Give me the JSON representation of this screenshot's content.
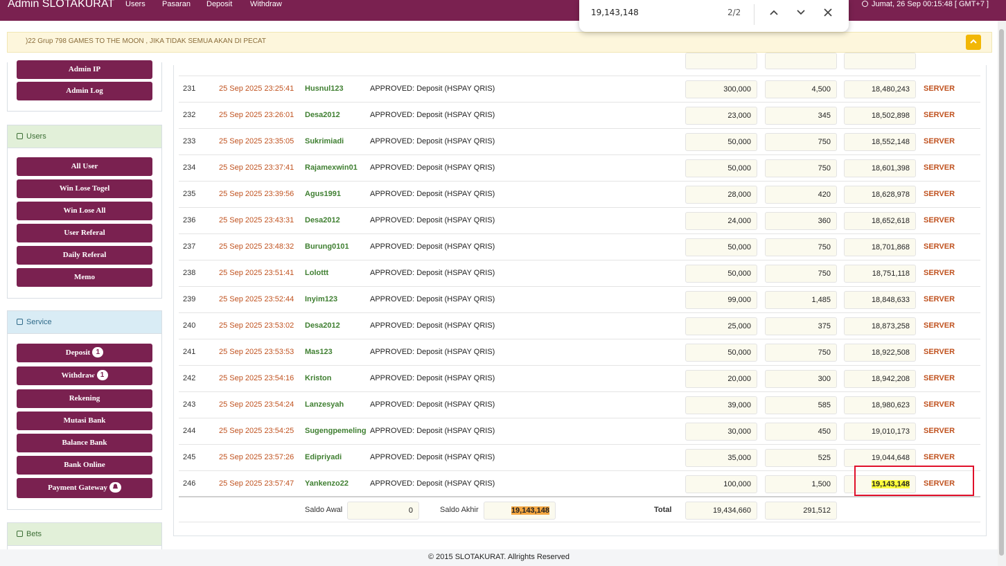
{
  "nav": {
    "brand": "Admin SLOTAKURAT",
    "links": [
      "Users",
      "Pasaran",
      "Deposit",
      "Withdraw"
    ],
    "datetime": "Jumat, 26 Sep 00:15:48 [ GMT+7 ]"
  },
  "findbar": {
    "query": "19,143,148",
    "count": "2/2"
  },
  "marquee": {
    "text": ")22 Grup 798 GAMES TO THE MOON , JIKA TIDAK SEMUA AKAN DI PECAT"
  },
  "sidebar": {
    "top_items": [
      "Admin IP",
      "Admin Log"
    ],
    "users_title": "Users",
    "users_items": [
      "All User",
      "Win Lose Togel",
      "Win Lose All",
      "User Referal",
      "Daily Referal",
      "Memo"
    ],
    "service_title": "Service",
    "service_items": [
      {
        "label": "Deposit",
        "badge": "1"
      },
      {
        "label": "Withdraw",
        "badge": "1"
      },
      {
        "label": "Rekening",
        "badge": ""
      },
      {
        "label": "Mutasi Bank",
        "badge": ""
      },
      {
        "label": "Balance Bank",
        "badge": ""
      },
      {
        "label": "Bank Online",
        "badge": ""
      },
      {
        "label": "Payment Gateway",
        "badge": ""
      }
    ],
    "bets_title": "Bets"
  },
  "table": {
    "rows": [
      {
        "no": "231",
        "date": "25 Sep 2025 23:25:41",
        "user": "Husnul123",
        "desc": "APPROVED: Deposit (HSPAY QRIS)",
        "amount": "300,000",
        "fee": "4,500",
        "balance": "18,480,243",
        "source": "SERVER"
      },
      {
        "no": "232",
        "date": "25 Sep 2025 23:26:01",
        "user": "Desa2012",
        "desc": "APPROVED: Deposit (HSPAY QRIS)",
        "amount": "23,000",
        "fee": "345",
        "balance": "18,502,898",
        "source": "SERVER"
      },
      {
        "no": "233",
        "date": "25 Sep 2025 23:35:05",
        "user": "Sukrimiadi",
        "desc": "APPROVED: Deposit (HSPAY QRIS)",
        "amount": "50,000",
        "fee": "750",
        "balance": "18,552,148",
        "source": "SERVER"
      },
      {
        "no": "234",
        "date": "25 Sep 2025 23:37:41",
        "user": "Rajamexwin01",
        "desc": "APPROVED: Deposit (HSPAY QRIS)",
        "amount": "50,000",
        "fee": "750",
        "balance": "18,601,398",
        "source": "SERVER"
      },
      {
        "no": "235",
        "date": "25 Sep 2025 23:39:56",
        "user": "Agus1991",
        "desc": "APPROVED: Deposit (HSPAY QRIS)",
        "amount": "28,000",
        "fee": "420",
        "balance": "18,628,978",
        "source": "SERVER"
      },
      {
        "no": "236",
        "date": "25 Sep 2025 23:43:31",
        "user": "Desa2012",
        "desc": "APPROVED: Deposit (HSPAY QRIS)",
        "amount": "24,000",
        "fee": "360",
        "balance": "18,652,618",
        "source": "SERVER"
      },
      {
        "no": "237",
        "date": "25 Sep 2025 23:48:32",
        "user": "Burung0101",
        "desc": "APPROVED: Deposit (HSPAY QRIS)",
        "amount": "50,000",
        "fee": "750",
        "balance": "18,701,868",
        "source": "SERVER"
      },
      {
        "no": "238",
        "date": "25 Sep 2025 23:51:41",
        "user": "Lolottt",
        "desc": "APPROVED: Deposit (HSPAY QRIS)",
        "amount": "50,000",
        "fee": "750",
        "balance": "18,751,118",
        "source": "SERVER"
      },
      {
        "no": "239",
        "date": "25 Sep 2025 23:52:44",
        "user": "Inyim123",
        "desc": "APPROVED: Deposit (HSPAY QRIS)",
        "amount": "99,000",
        "fee": "1,485",
        "balance": "18,848,633",
        "source": "SERVER"
      },
      {
        "no": "240",
        "date": "25 Sep 2025 23:53:02",
        "user": "Desa2012",
        "desc": "APPROVED: Deposit (HSPAY QRIS)",
        "amount": "25,000",
        "fee": "375",
        "balance": "18,873,258",
        "source": "SERVER"
      },
      {
        "no": "241",
        "date": "25 Sep 2025 23:53:53",
        "user": "Mas123",
        "desc": "APPROVED: Deposit (HSPAY QRIS)",
        "amount": "50,000",
        "fee": "750",
        "balance": "18,922,508",
        "source": "SERVER"
      },
      {
        "no": "242",
        "date": "25 Sep 2025 23:54:16",
        "user": "Kriston",
        "desc": "APPROVED: Deposit (HSPAY QRIS)",
        "amount": "20,000",
        "fee": "300",
        "balance": "18,942,208",
        "source": "SERVER"
      },
      {
        "no": "243",
        "date": "25 Sep 2025 23:54:24",
        "user": "Lanzesyah",
        "desc": "APPROVED: Deposit (HSPAY QRIS)",
        "amount": "39,000",
        "fee": "585",
        "balance": "18,980,623",
        "source": "SERVER"
      },
      {
        "no": "244",
        "date": "25 Sep 2025 23:54:25",
        "user": "Sugengpemeling",
        "desc": "APPROVED: Deposit (HSPAY QRIS)",
        "amount": "30,000",
        "fee": "450",
        "balance": "19,010,173",
        "source": "SERVER"
      },
      {
        "no": "245",
        "date": "25 Sep 2025 23:57:26",
        "user": "Edipriyadi",
        "desc": "APPROVED: Deposit (HSPAY QRIS)",
        "amount": "35,000",
        "fee": "525",
        "balance": "19,044,648",
        "source": "SERVER"
      },
      {
        "no": "246",
        "date": "25 Sep 2025 23:57:47",
        "user": "Yankenzo22",
        "desc": "APPROVED: Deposit (HSPAY QRIS)",
        "amount": "100,000",
        "fee": "1,500",
        "balance": "19,143,148",
        "source": "SERVER"
      }
    ],
    "summary": {
      "saldo_awal_label": "Saldo Awal",
      "saldo_awal": "0",
      "saldo_akhir_label": "Saldo Akhir",
      "saldo_akhir": "19,143,148",
      "total_label": "Total",
      "total_amount": "19,434,660",
      "total_fee": "291,512"
    }
  },
  "footer": {
    "text": "© 2015 SLOTAKURAT. Allrights Reserved"
  },
  "colors": {
    "primary": "#7a2150",
    "highlight": "#ffff3c",
    "active_highlight": "#f4a742",
    "server": "#c0521f",
    "user": "#3f7f31"
  }
}
